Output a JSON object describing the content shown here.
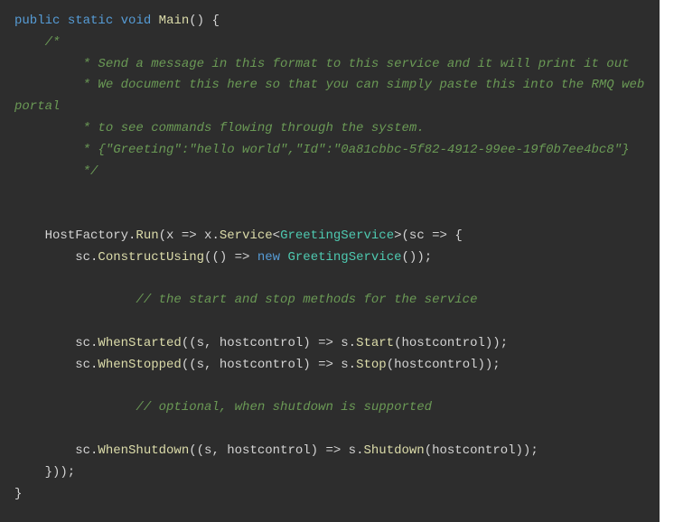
{
  "code": {
    "line1": {
      "kw_public": "public",
      "kw_static": "static",
      "kw_void": "void",
      "method": "Main",
      "rest": "() {"
    },
    "comment": {
      "c1": "    /*",
      "c2": "         * Send a message in this format to this service and it will print it out",
      "c3": "         * We document this here so that you can simply paste this into the RMQ web ",
      "c3b": "portal",
      "c4": "         * to see commands flowing through the system.",
      "c5": "         * {\"Greeting\":\"hello world\",\"Id\":\"0a81cbbc-5f82-4912-99ee-19f0b7ee4bc8\"}",
      "c6": "         */"
    },
    "line_host": {
      "pre": "    HostFactory.",
      "run": "Run",
      "mid1": "(x => x.",
      "service": "Service",
      "lt": "<",
      "type1": "GreetingService",
      "gt": ">(sc => {"
    },
    "line_construct": {
      "pre": "        sc.",
      "method": "ConstructUsing",
      "mid": "(() => ",
      "new": "new",
      "sp": " ",
      "type": "GreetingService",
      "rest": "());"
    },
    "comment_start_stop": "                // the start and stop methods for the service",
    "line_started": {
      "pre": "        sc.",
      "method": "WhenStarted",
      "args": "((s, hostcontrol) => s.",
      "call": "Start",
      "rest": "(hostcontrol));"
    },
    "line_stopped": {
      "pre": "        sc.",
      "method": "WhenStopped",
      "args": "((s, hostcontrol) => s.",
      "call": "Stop",
      "rest": "(hostcontrol));"
    },
    "comment_optional": "                // optional, when shutdown is supported",
    "line_shutdown": {
      "pre": "        sc.",
      "method": "WhenShutdown",
      "args": "((s, hostcontrol) => s.",
      "call": "Shutdown",
      "rest": "(hostcontrol));"
    },
    "line_close1": "    }));",
    "line_close2": "}"
  }
}
